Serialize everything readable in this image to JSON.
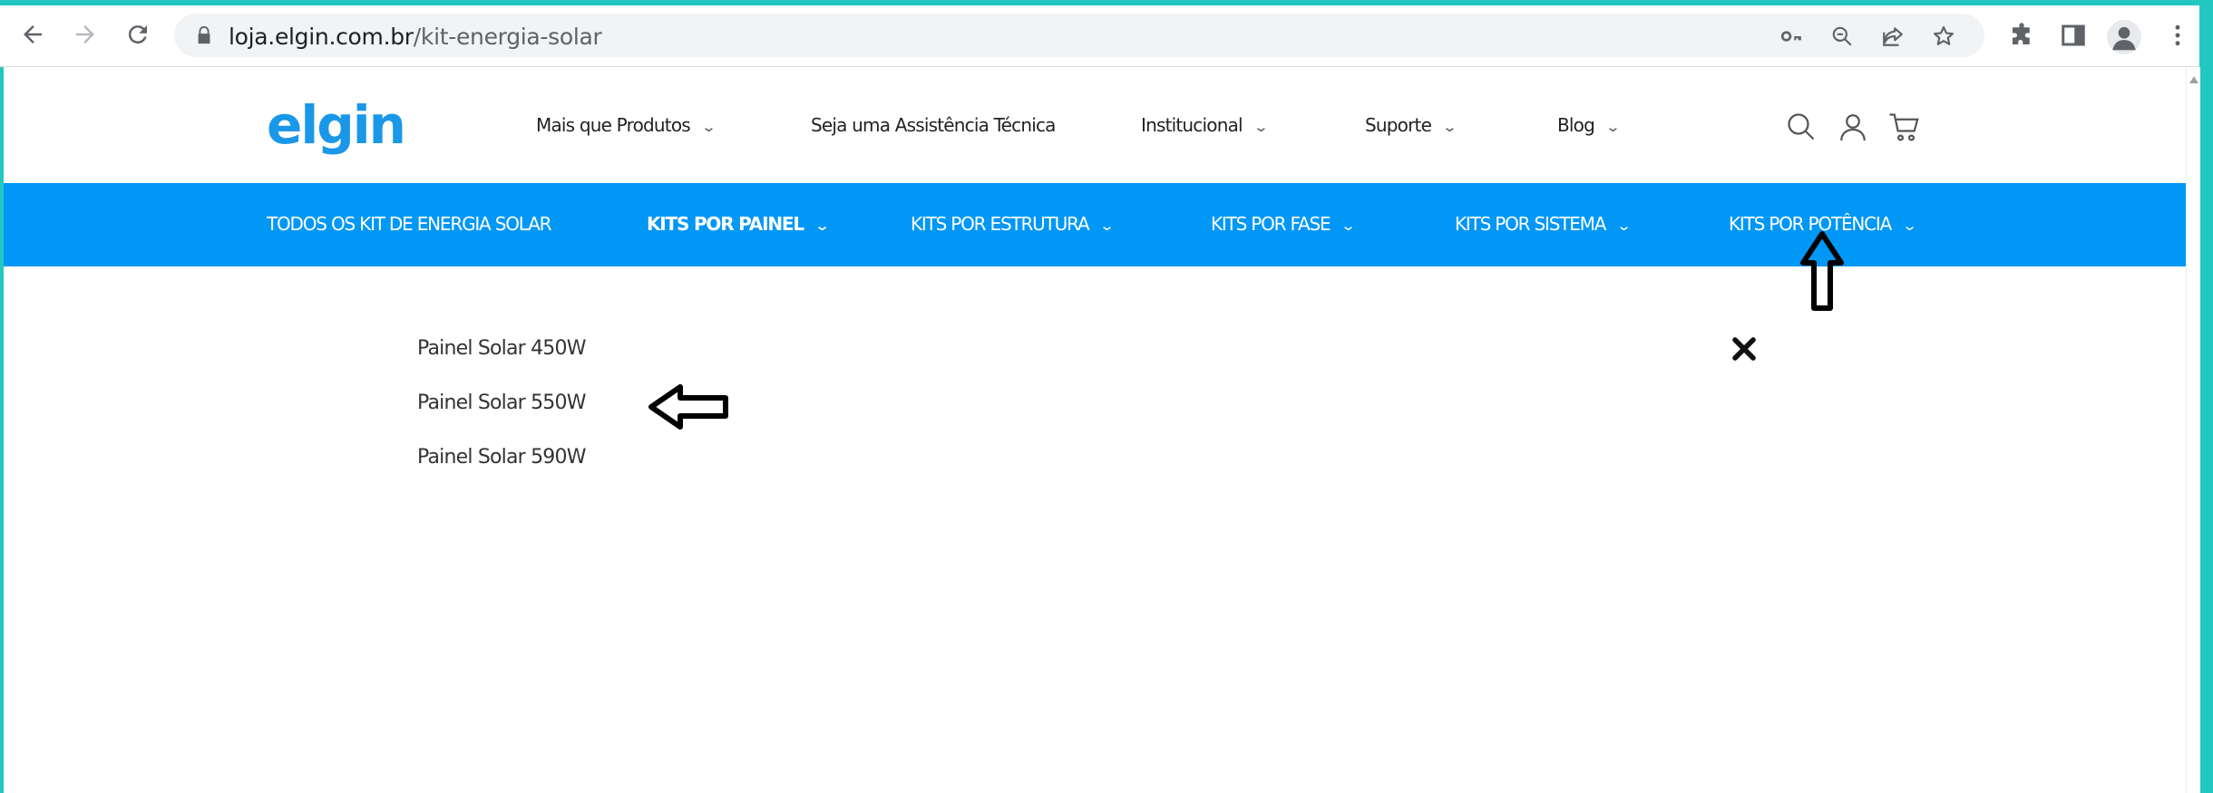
{
  "browser": {
    "url_host": "loja.elgin.com.br",
    "url_path": "/kit-energia-solar"
  },
  "site": {
    "logo_text": "elgin",
    "brand_color": "#1b97e8",
    "top_nav": [
      {
        "label": "Mais que Produtos",
        "has_dropdown": true
      },
      {
        "label": "Seja uma Assistência Técnica",
        "has_dropdown": false
      },
      {
        "label": "Institucional",
        "has_dropdown": true
      },
      {
        "label": "Suporte",
        "has_dropdown": true
      },
      {
        "label": "Blog",
        "has_dropdown": true
      }
    ],
    "header_icons": [
      "search-icon",
      "user-icon",
      "cart-icon"
    ]
  },
  "category_bar": {
    "color": "#0097f6",
    "items": [
      {
        "label": "TODOS OS KIT DE ENERGIA SOLAR",
        "has_dropdown": false
      },
      {
        "label": "KITS POR PAINEL",
        "has_dropdown": true,
        "active": true
      },
      {
        "label": "KITS POR ESTRUTURA",
        "has_dropdown": true
      },
      {
        "label": "KITS POR FASE",
        "has_dropdown": true
      },
      {
        "label": "KITS POR SISTEMA",
        "has_dropdown": true
      },
      {
        "label": "KITS POR POTÊNCIA",
        "has_dropdown": true
      }
    ]
  },
  "dropdown": {
    "items": [
      "Painel Solar 450W",
      "Painel Solar 550W",
      "Painel Solar 590W"
    ]
  }
}
